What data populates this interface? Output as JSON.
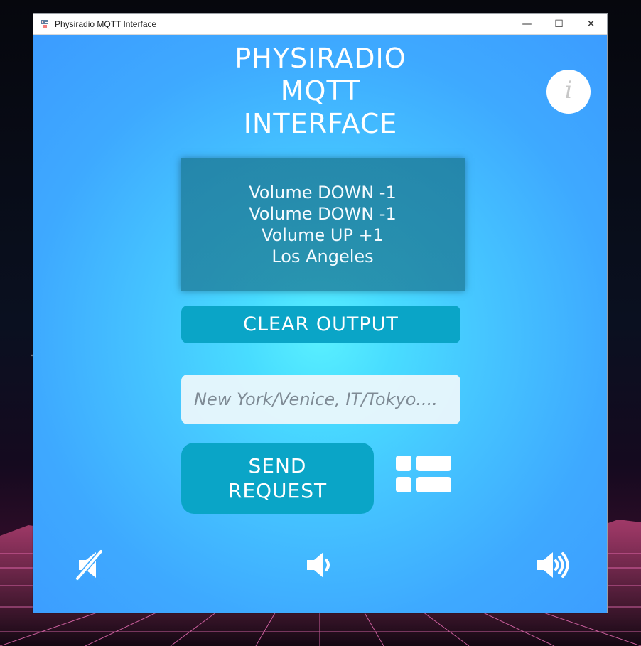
{
  "window": {
    "title": "Physiradio MQTT Interface",
    "controls": {
      "minimize_icon": "minimize-icon",
      "maximize_icon": "maximize-icon",
      "close_icon": "close-icon"
    }
  },
  "header": {
    "title_lines": [
      "PHYSIRADIO",
      "MQTT",
      "INTERFACE"
    ]
  },
  "output": {
    "lines": [
      "Volume DOWN -1",
      "Volume DOWN -1",
      "Volume UP +1",
      "Los Angeles"
    ]
  },
  "actions": {
    "clear_label": "CLEAR OUTPUT",
    "send_label_lines": [
      "SEND",
      "REQUEST"
    ]
  },
  "city_input": {
    "value": "",
    "placeholder": "New York/Venice, IT/Tokyo...."
  },
  "icons": {
    "info": "info-icon",
    "list": "list-icon",
    "mute": "mute-icon",
    "volume_down": "volume-down-icon",
    "volume_up": "volume-up-icon"
  },
  "colors": {
    "window_bg_center": "#59f0ff",
    "window_bg_edge": "#3c9cff",
    "button": "#0aa5c7",
    "panel": "#1f7f96",
    "text_light": "#ffffff",
    "input_bg": "#eef8fc",
    "info_icon": "#c8c8c8"
  }
}
